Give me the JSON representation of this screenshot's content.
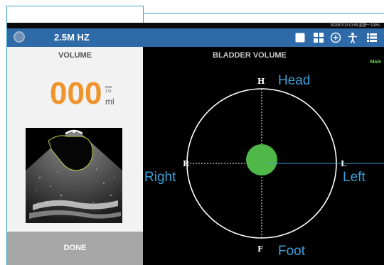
{
  "status_bar": {
    "text": "2020/07/13 01:59 星期一     100%"
  },
  "app_bar": {
    "frequency": "2.5M HZ",
    "icons": [
      "logo-icon",
      "square-icon",
      "grid-icon",
      "add-circle-icon",
      "person-icon",
      "list-icon"
    ]
  },
  "left_panel": {
    "title": "VOLUME",
    "volume_value": "000",
    "max_label": "max",
    "max_value": "174",
    "unit": "ml",
    "done_label": "DONE"
  },
  "right_panel": {
    "title": "BLADDER VOLUME",
    "gender": "Male",
    "axis_letters": {
      "top": "H",
      "left": "R",
      "right": "L",
      "bottom": "F"
    },
    "direction_labels": {
      "head": "Head",
      "right": "Right",
      "left": "Left",
      "foot": "Foot"
    }
  },
  "colors": {
    "app_bar": "#2f6aa8",
    "volume_value": "#f0932b",
    "bladder_dot": "#4fb848",
    "gender": "#6ad04a",
    "annotation": "#3b9fd8"
  }
}
